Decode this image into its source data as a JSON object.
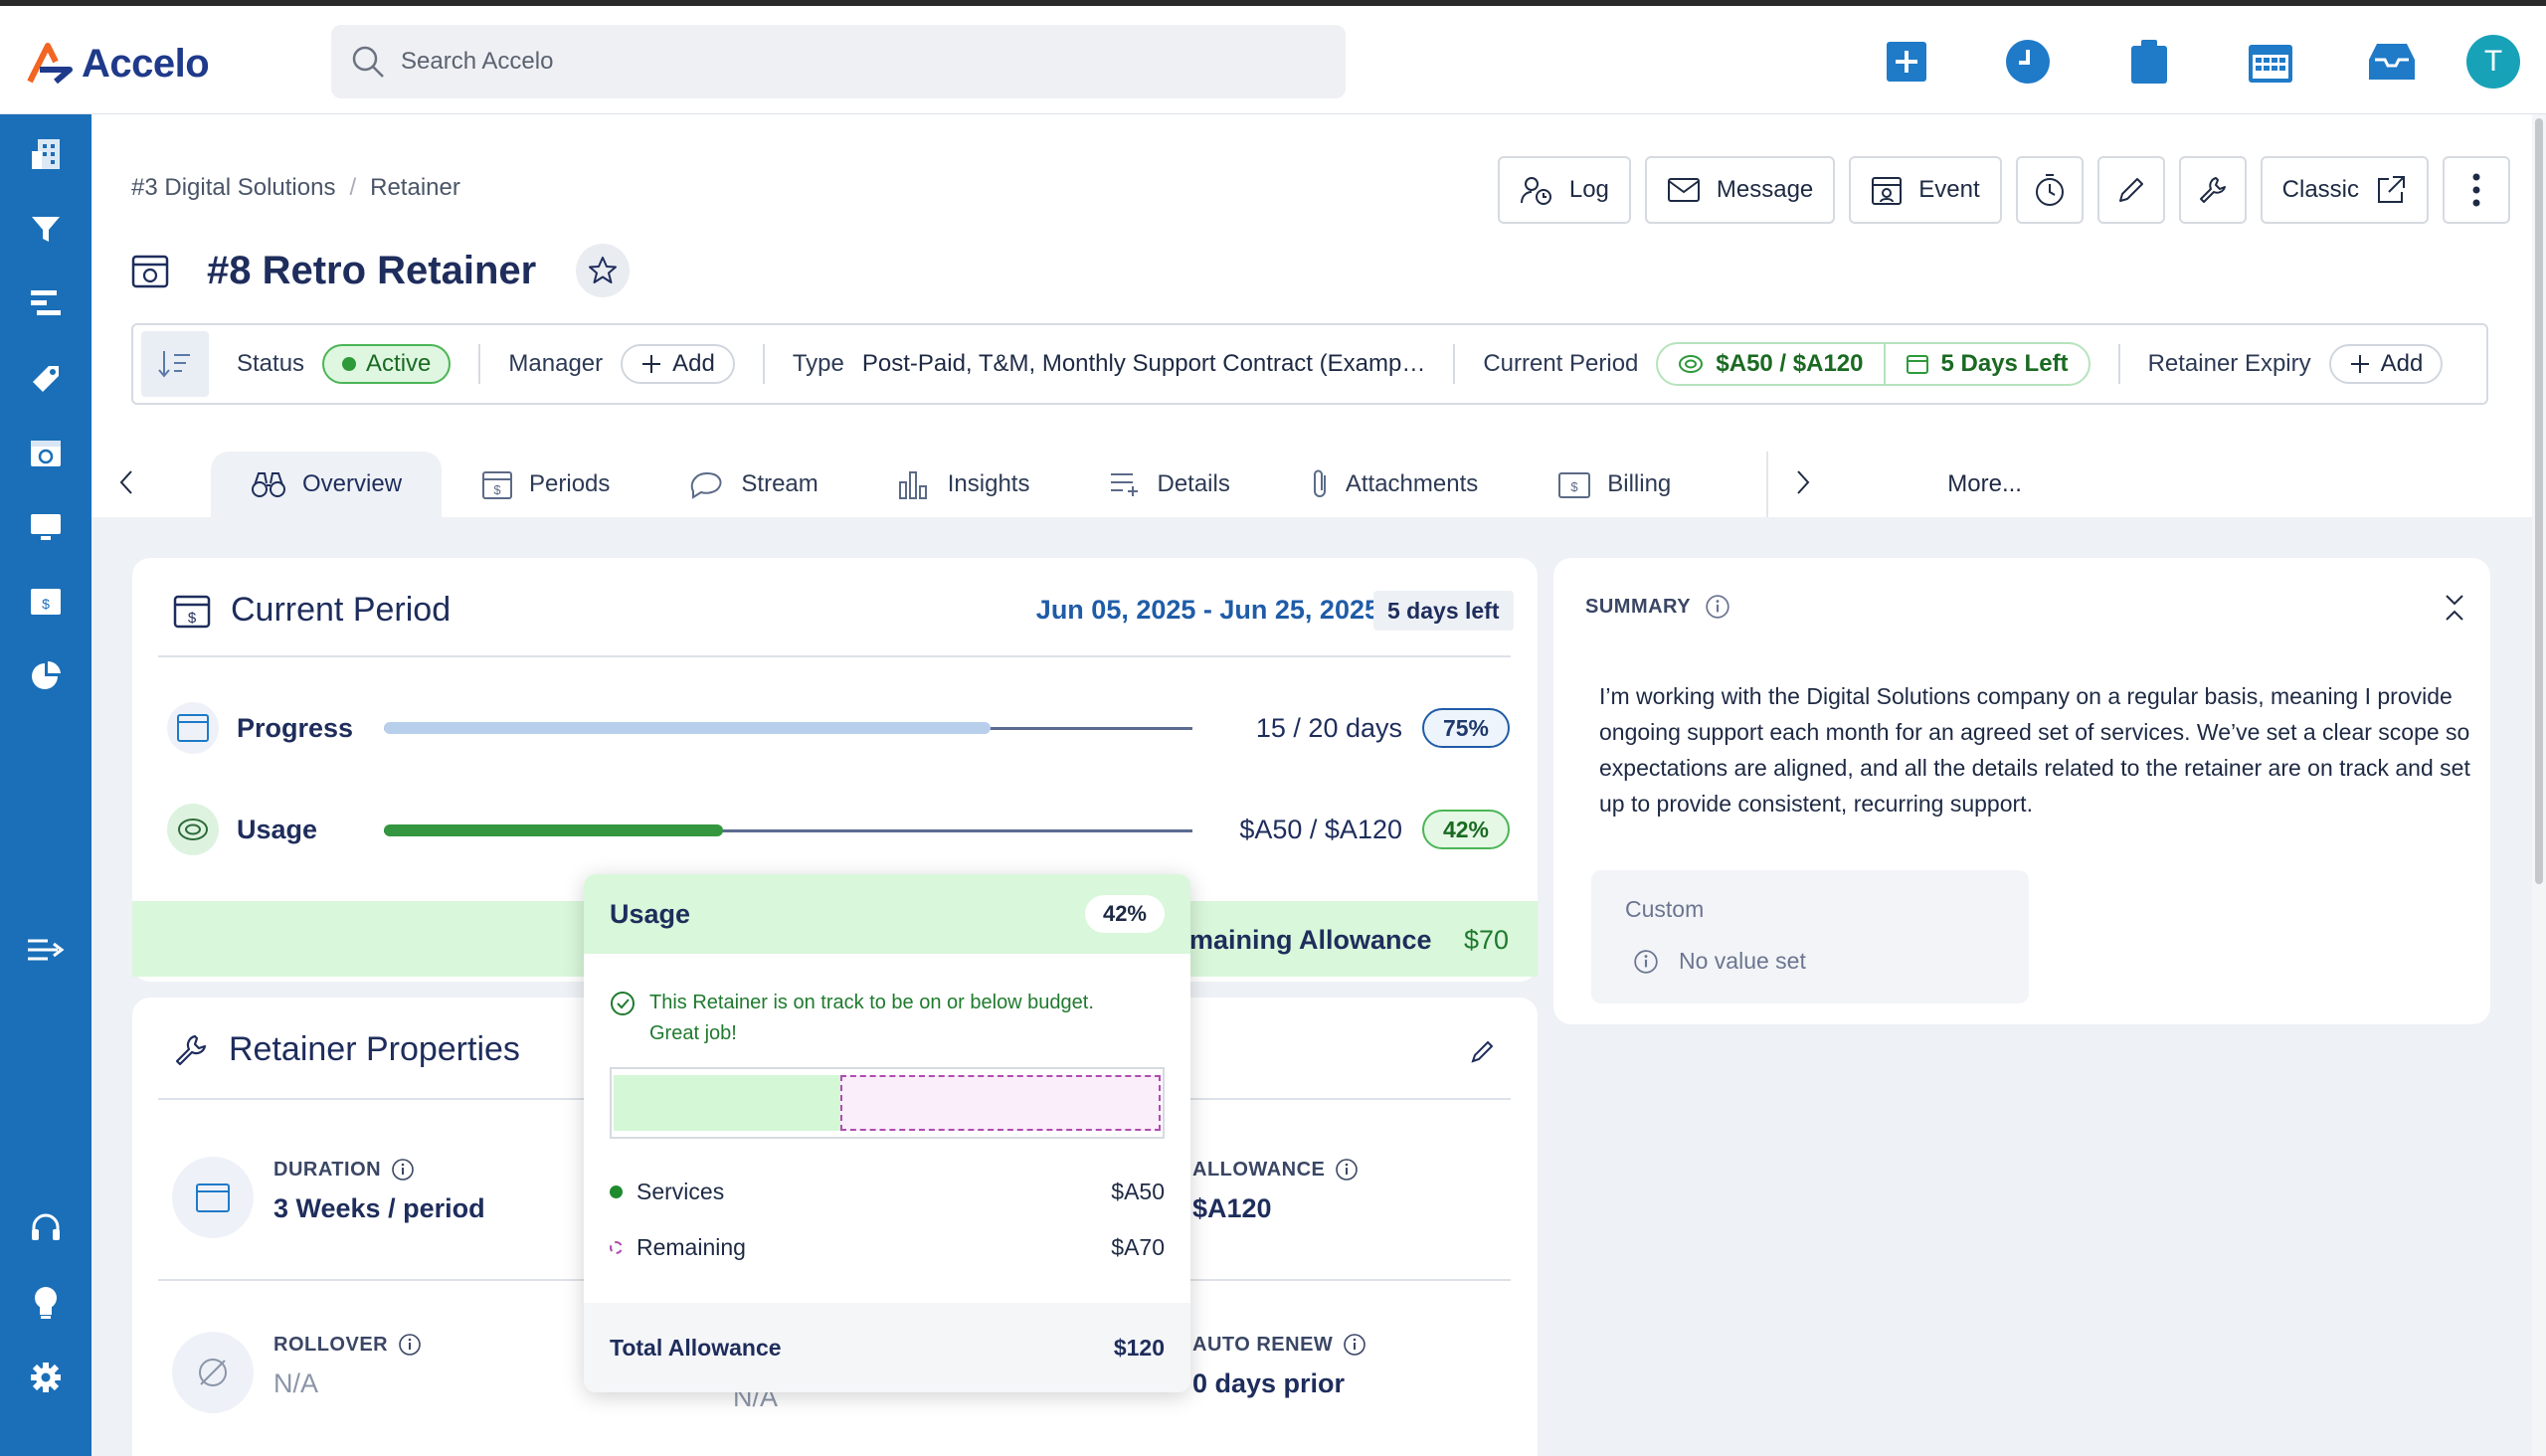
{
  "app": {
    "logo_text": "Accelo"
  },
  "search": {
    "placeholder": "Search Accelo"
  },
  "top_icons": [
    "plus-square-icon",
    "clock-icon",
    "clipboard-icon",
    "calendar-icon",
    "inbox-icon"
  ],
  "user": {
    "avatar_initial": "T"
  },
  "breadcrumb": [
    "#3 Digital Solutions",
    "Retainer"
  ],
  "page": {
    "title": "#8 Retro Retainer"
  },
  "actions": {
    "log": "Log",
    "message": "Message",
    "event": "Event",
    "classic": "Classic"
  },
  "statusbar": {
    "status_label": "Status",
    "status_value": "Active",
    "manager_label": "Manager",
    "manager_add": "Add",
    "type_label": "Type",
    "type_value": "Post-Paid, T&M, Monthly Support Contract (Examp…",
    "period_label": "Current Period",
    "period_usage": "$A50 / $A120",
    "period_left": "5 Days Left",
    "expiry_label": "Retainer Expiry",
    "expiry_add": "Add"
  },
  "tabs": [
    "Overview",
    "Periods",
    "Stream",
    "Insights",
    "Details",
    "Attachments",
    "Billing"
  ],
  "tabs_more": "More...",
  "current_period": {
    "title": "Current Period",
    "range": "Jun 05, 2025 - Jun 25, 2025",
    "days_left": "5 days left",
    "progress": {
      "label": "Progress",
      "value": "15 / 20 days",
      "percent": "75%",
      "fraction": 0.75
    },
    "usage": {
      "label": "Usage",
      "value": "$A50 / $A120",
      "percent": "42%",
      "fraction": 0.42
    },
    "remaining_label": "maining Allowance",
    "remaining_value": "$70"
  },
  "properties": {
    "title": "Retainer Properties",
    "duration_label": "DURATION",
    "duration_value": "3 Weeks / period",
    "allowance_label": "ALLOWANCE",
    "allowance_value": "$A120",
    "rollover_label": "ROLLOVER",
    "rollover_value": "N/A",
    "middle_value": "N/A",
    "autorenew_label": "AUTO RENEW",
    "autorenew_value": "0 days prior"
  },
  "summary": {
    "title": "SUMMARY",
    "text": "I’m working with the Digital Solutions company on a regular basis, meaning I provide ongoing support each month for an agreed set of services. We’ve set a clear scope so expectations are aligned, and all the details related to the retainer are on track and set up to provide consistent, recurring support.",
    "custom_label": "Custom",
    "custom_value": "No value set"
  },
  "popover": {
    "title": "Usage",
    "percent": "42%",
    "message": "This Retainer is on track to be on or below budget. Great job!",
    "services_label": "Services",
    "services_value": "$A50",
    "remaining_label": "Remaining",
    "remaining_value": "$A70",
    "total_label": "Total Allowance",
    "total_value": "$120"
  },
  "colors": {
    "sidebar": "#1a6fb8",
    "accent": "#1f7ac8",
    "success": "#2e9a3a"
  }
}
